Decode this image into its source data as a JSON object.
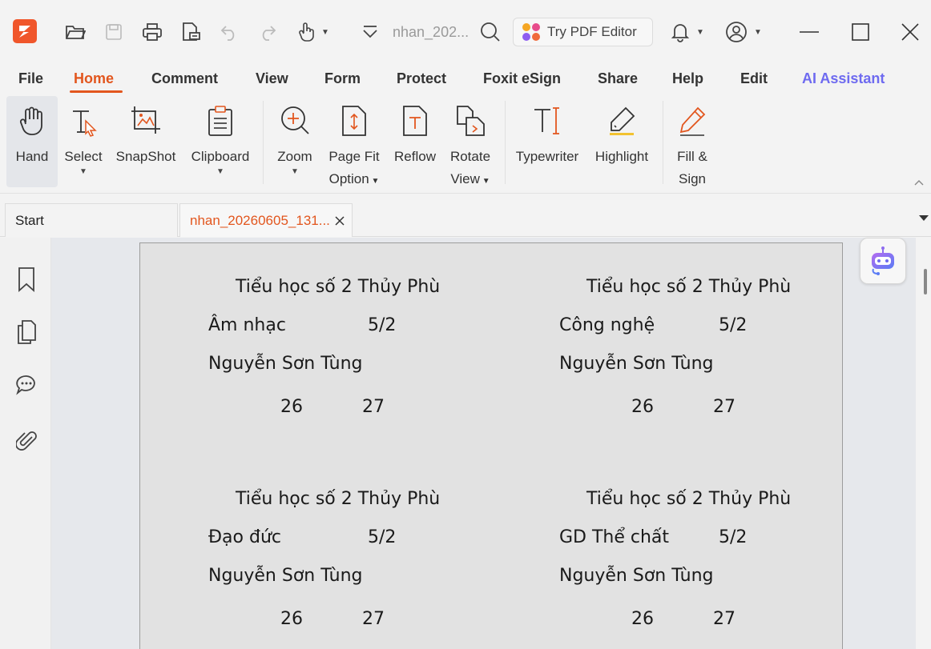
{
  "titlebar": {
    "doc_title": "nhan_202...",
    "try_editor_label": "Try PDF Editor"
  },
  "menu": [
    "File",
    "Home",
    "Comment",
    "View",
    "Form",
    "Protect",
    "Foxit eSign",
    "Share",
    "Help",
    "Edit",
    "AI Assistant"
  ],
  "ribbon": {
    "hand": "Hand",
    "select": "Select",
    "snapshot": "SnapShot",
    "clipboard": "Clipboard",
    "zoom": "Zoom",
    "page_fit_1": "Page Fit",
    "page_fit_2": "Option",
    "reflow": "Reflow",
    "rotate_1": "Rotate",
    "rotate_2": "View",
    "typewriter": "Typewriter",
    "highlight": "Highlight",
    "fill_sign_1": "Fill &",
    "fill_sign_2": "Sign"
  },
  "tabs": {
    "start": "Start",
    "doc": "nhan_20260605_131..."
  },
  "document": {
    "labels": [
      {
        "school": "Tiểu học số 2 Thủy Phù",
        "subject": "Âm nhạc",
        "class": "5/2",
        "teacher": "Nguyễn Sơn Tùng",
        "n1": "26",
        "n2": "27"
      },
      {
        "school": "Tiểu học số 2 Thủy Phù",
        "subject": "Công nghệ",
        "class": "5/2",
        "teacher": "Nguyễn Sơn Tùng",
        "n1": "26",
        "n2": "27"
      },
      {
        "school": "Tiểu học số 2 Thủy Phù",
        "subject": "Đạo đức",
        "class": "5/2",
        "teacher": "Nguyễn Sơn Tùng",
        "n1": "26",
        "n2": "27"
      },
      {
        "school": "Tiểu học số 2 Thủy Phù",
        "subject": "GD Thể chất",
        "class": "5/2",
        "teacher": "Nguyễn Sơn Tùng",
        "n1": "26",
        "n2": "27"
      }
    ]
  },
  "colors": {
    "accent": "#e2561e",
    "ai": "#6e6af0"
  }
}
